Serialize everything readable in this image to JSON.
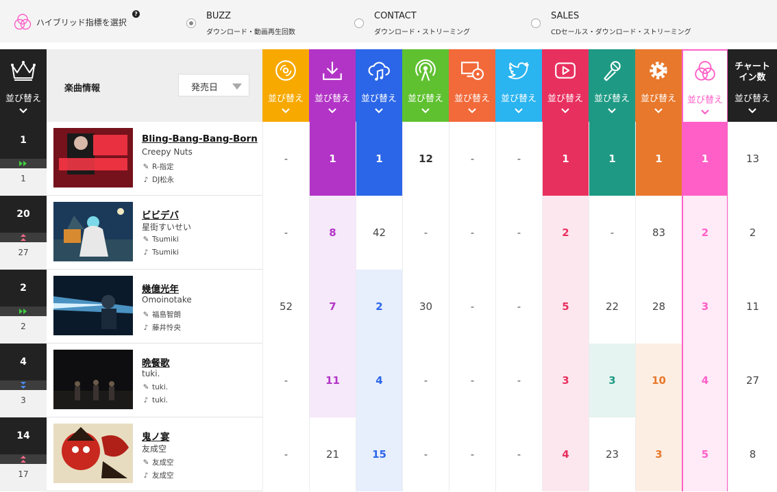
{
  "topbar": {
    "hybrid_label": "ハイブリッド指標を選択",
    "help": "?",
    "options": [
      {
        "title": "BUZZ",
        "sub": "ダウンロード・動画再生回数",
        "checked": true
      },
      {
        "title": "CONTACT",
        "sub": "ダウンロード・ストリーミング",
        "checked": false
      },
      {
        "title": "SALES",
        "sub": "CDセールス・ダウンロード・ストリーミング",
        "checked": false
      }
    ]
  },
  "header": {
    "rank_sort": "並び替え",
    "info_title": "楽曲情報",
    "release_select": "発売日",
    "count_title_1": "チャート",
    "count_title_2": "イン数",
    "count_sort": "並び替え",
    "columns": [
      {
        "icon": "cd-icon",
        "sort": "並び替え",
        "color": "#f7a900"
      },
      {
        "icon": "download-icon",
        "sort": "並び替え",
        "color": "#b234c6"
      },
      {
        "icon": "cloud-music-icon",
        "sort": "並び替え",
        "color": "#2b66e8"
      },
      {
        "icon": "radio-icon",
        "sort": "並び替え",
        "color": "#5fc130"
      },
      {
        "icon": "tv-disc-icon",
        "sort": "並び替え",
        "color": "#f2693a"
      },
      {
        "icon": "twitter-icon",
        "sort": "並び替え",
        "color": "#2ab4f0"
      },
      {
        "icon": "play-video-icon",
        "sort": "並び替え",
        "color": "#e8305f"
      },
      {
        "icon": "microphone-icon",
        "sort": "並び替え",
        "color": "#1e9a84"
      },
      {
        "icon": "gear-play-icon",
        "sort": "並び替え",
        "color": "#e8782b"
      },
      {
        "icon": "hybrid-icon",
        "sort": "並び替え",
        "color": "#ff5fc7"
      }
    ]
  },
  "rows": [
    {
      "rank": "1",
      "trend": "stay",
      "prev": "1",
      "title": "Bling-Bang-Bang-Born",
      "artist": "Creepy Nuts",
      "lyricist": "R-指定",
      "composer": "DJ松永",
      "values": [
        "-",
        "1",
        "1",
        "12",
        "-",
        "-",
        "1",
        "1",
        "1",
        "1",
        "13"
      ]
    },
    {
      "rank": "20",
      "trend": "up",
      "prev": "27",
      "title": "ビビデバ",
      "artist": "星街すいせい",
      "lyricist": "Tsumiki",
      "composer": "Tsumiki",
      "values": [
        "-",
        "8",
        "42",
        "-",
        "-",
        "-",
        "2",
        "-",
        "83",
        "2",
        "2"
      ]
    },
    {
      "rank": "2",
      "trend": "stay",
      "prev": "2",
      "title": "幾億光年",
      "artist": "Omoinotake",
      "lyricist": "福島智朗",
      "composer": "藤井怜央",
      "values": [
        "52",
        "7",
        "2",
        "30",
        "-",
        "-",
        "5",
        "22",
        "28",
        "3",
        "11"
      ]
    },
    {
      "rank": "4",
      "trend": "down",
      "prev": "3",
      "title": "晩餐歌",
      "artist": "tuki.",
      "lyricist": "tuki.",
      "composer": "tuki.",
      "values": [
        "-",
        "11",
        "4",
        "-",
        "-",
        "-",
        "3",
        "3",
        "10",
        "4",
        "27"
      ]
    },
    {
      "rank": "14",
      "trend": "up",
      "prev": "17",
      "title": "鬼ノ宴",
      "artist": "友成空",
      "lyricist": "友成空",
      "composer": "友成空",
      "values": [
        "-",
        "21",
        "15",
        "-",
        "-",
        "-",
        "4",
        "23",
        "3",
        "5",
        "8"
      ]
    }
  ],
  "colors": {
    "dark": "#222222",
    "hybrid": "#ff5fc7",
    "trend_stay": "#40d040",
    "trend_up": "#ff6b8a",
    "trend_down": "#4a8df8"
  }
}
